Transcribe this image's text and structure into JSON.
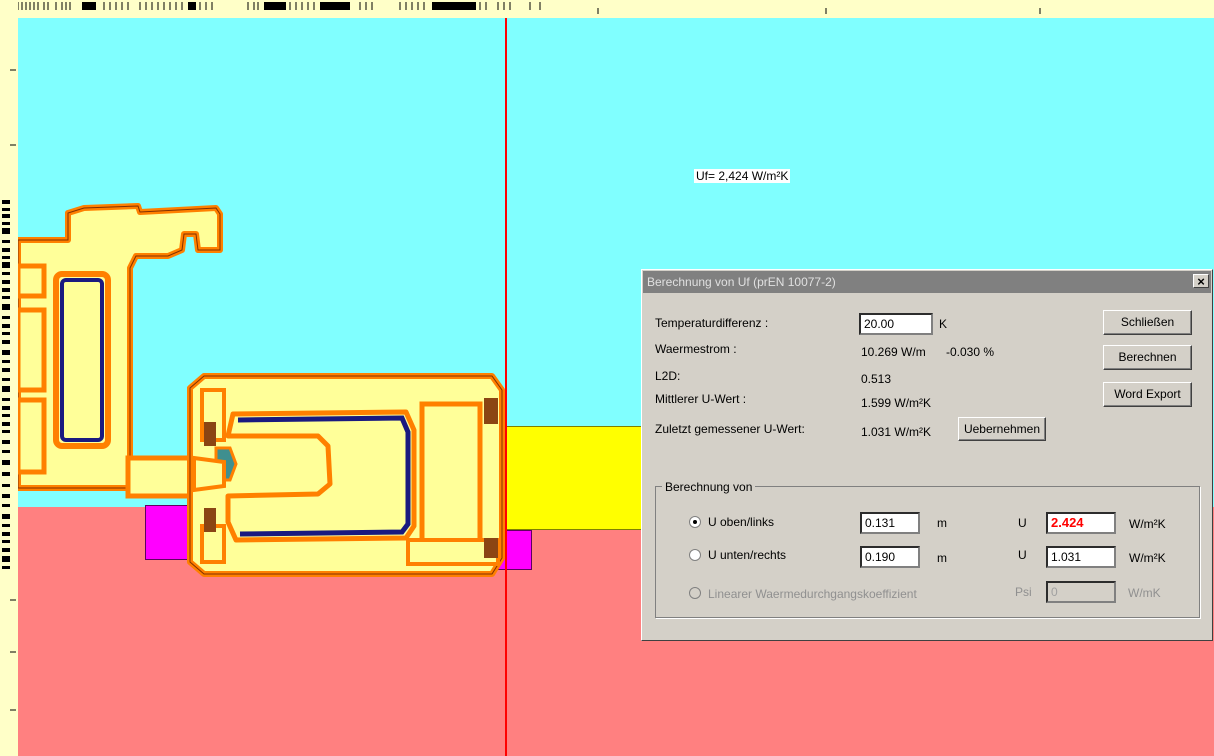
{
  "canvas": {
    "uf_label": "Uf= 2,424 W/m²K"
  },
  "dialog": {
    "title": "Berechnung von Uf (prEN 10077-2)",
    "close": "×",
    "rows": {
      "temp_label": "Temperaturdifferenz :",
      "temp_value": "20.00",
      "temp_unit": "K",
      "flow_label": "Waermestrom :",
      "flow_value": "10.269  W/m",
      "flow_pct": "-0.030  %",
      "l2d_label": "L2D:",
      "l2d_value": "0.513",
      "mean_label": "Mittlerer U-Wert :",
      "mean_value": "1.599  W/m²K",
      "last_label": "Zuletzt gemessener U-Wert:",
      "last_value": "1.031  W/m²K"
    },
    "buttons": {
      "close": "Schließen",
      "calc": "Berechnen",
      "export": "Word Export",
      "apply": "Uebernehmen"
    },
    "group": {
      "label": "Berechnung von",
      "opt1_label": "U oben/links",
      "opt1_len": "0.131",
      "opt1_len_unit": "m",
      "opt1_u": "U",
      "opt1_u_value": "2.424",
      "opt1_u_unit": "W/m²K",
      "opt2_label": "U unten/rechts",
      "opt2_len": "0.190",
      "opt2_len_unit": "m",
      "opt2_u": "U",
      "opt2_u_value": "1.031",
      "opt2_u_unit": "W/m²K",
      "opt3_label": "Linearer Waermedurchgangskoeffizient",
      "opt3_psi": "Psi",
      "opt3_value": "0",
      "opt3_unit": "W/mK"
    }
  }
}
